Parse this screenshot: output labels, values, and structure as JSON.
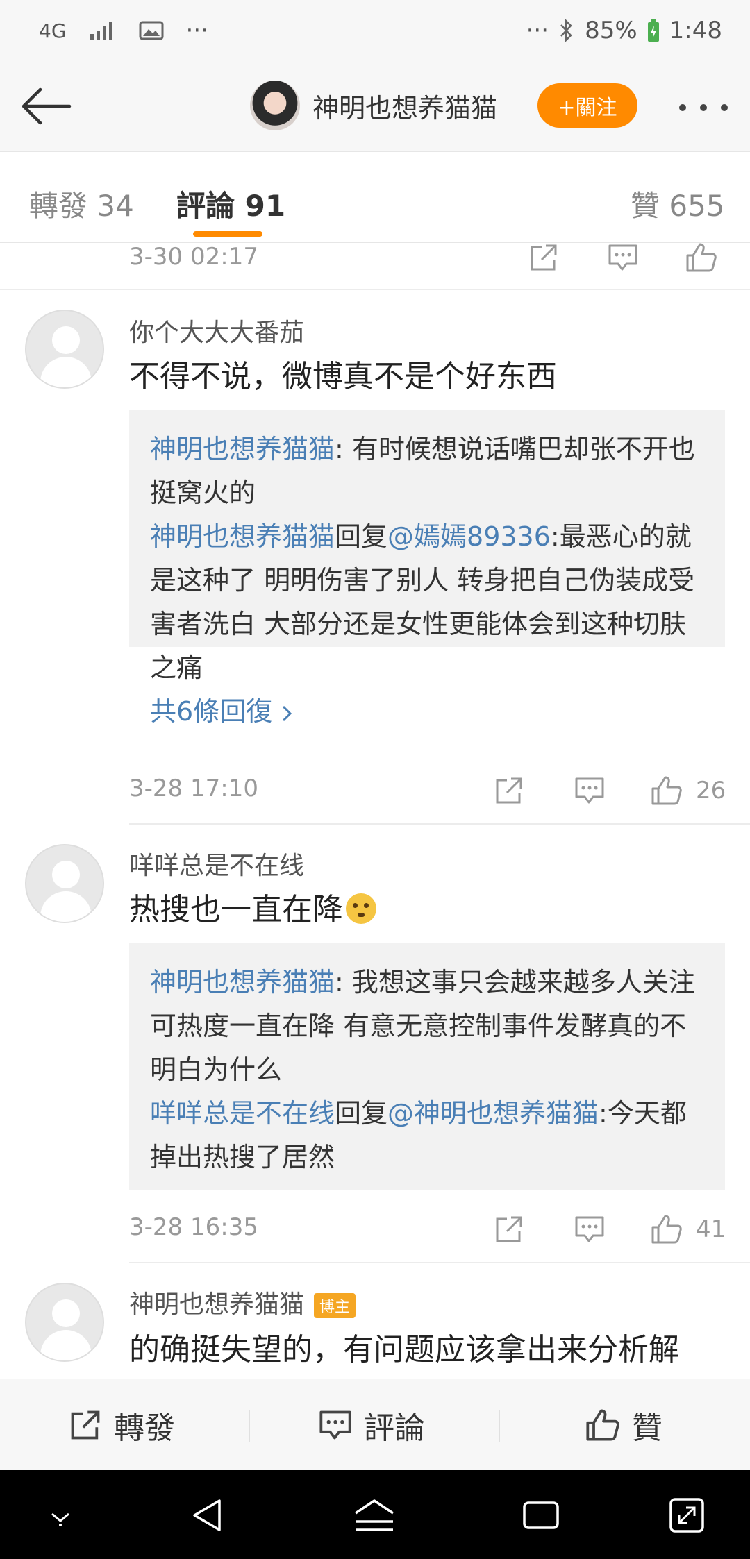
{
  "status_bar": {
    "network": "4G",
    "more": "···",
    "more_right": "···",
    "battery": "85%",
    "time": "1:48"
  },
  "header": {
    "username": "神明也想养猫猫",
    "follow_label": "+關注"
  },
  "tabs": [
    {
      "label": "轉發 34"
    },
    {
      "label": "評論 91"
    },
    {
      "label": "贊 655"
    }
  ],
  "accent_color": "#ff8a00",
  "link_color": "#4a7fb5",
  "top_meta": {
    "date": "3-30 02:17"
  },
  "comments": [
    {
      "user": "你个大大大番茄",
      "text": "不得不说，微博真不是个好东西",
      "replies": [
        {
          "user": "神明也想养猫猫",
          "sep": ": ",
          "text": "有时候想说话嘴巴却张不开也挺窝火的"
        },
        {
          "user": "神明也想养猫猫",
          "reply_word": "回复",
          "mention": "@嫣嫣89336",
          "sep": ":",
          "text": "最恶心的就是这种了 明明伤害了别人 转身把自己伪装成受害者洗白 大部分还是女性更能体会到这种切肤之痛"
        }
      ],
      "more_replies": "共6條回復",
      "date": "3-28 17:10",
      "likes": "26"
    },
    {
      "user": "咩咩总是不在线",
      "text": "热搜也一直在降",
      "replies": [
        {
          "user": "神明也想养猫猫",
          "sep": ": ",
          "text": "我想这事只会越来越多人关注 可热度一直在降 有意无意控制事件发酵真的不明白为什么"
        },
        {
          "user": "咩咩总是不在线",
          "reply_word": "回复",
          "mention": "@神明也想养猫猫",
          "sep": ":",
          "text": "今天都掉出热搜了居然"
        }
      ],
      "date": "3-28 16:35",
      "likes": "41"
    },
    {
      "user": "神明也想养猫猫",
      "badge": "博主",
      "text": "的确挺失望的，有问题应该拿出来分析解"
    }
  ],
  "bottom_bar": {
    "repost": "轉發",
    "comment": "評論",
    "like": "贊"
  }
}
